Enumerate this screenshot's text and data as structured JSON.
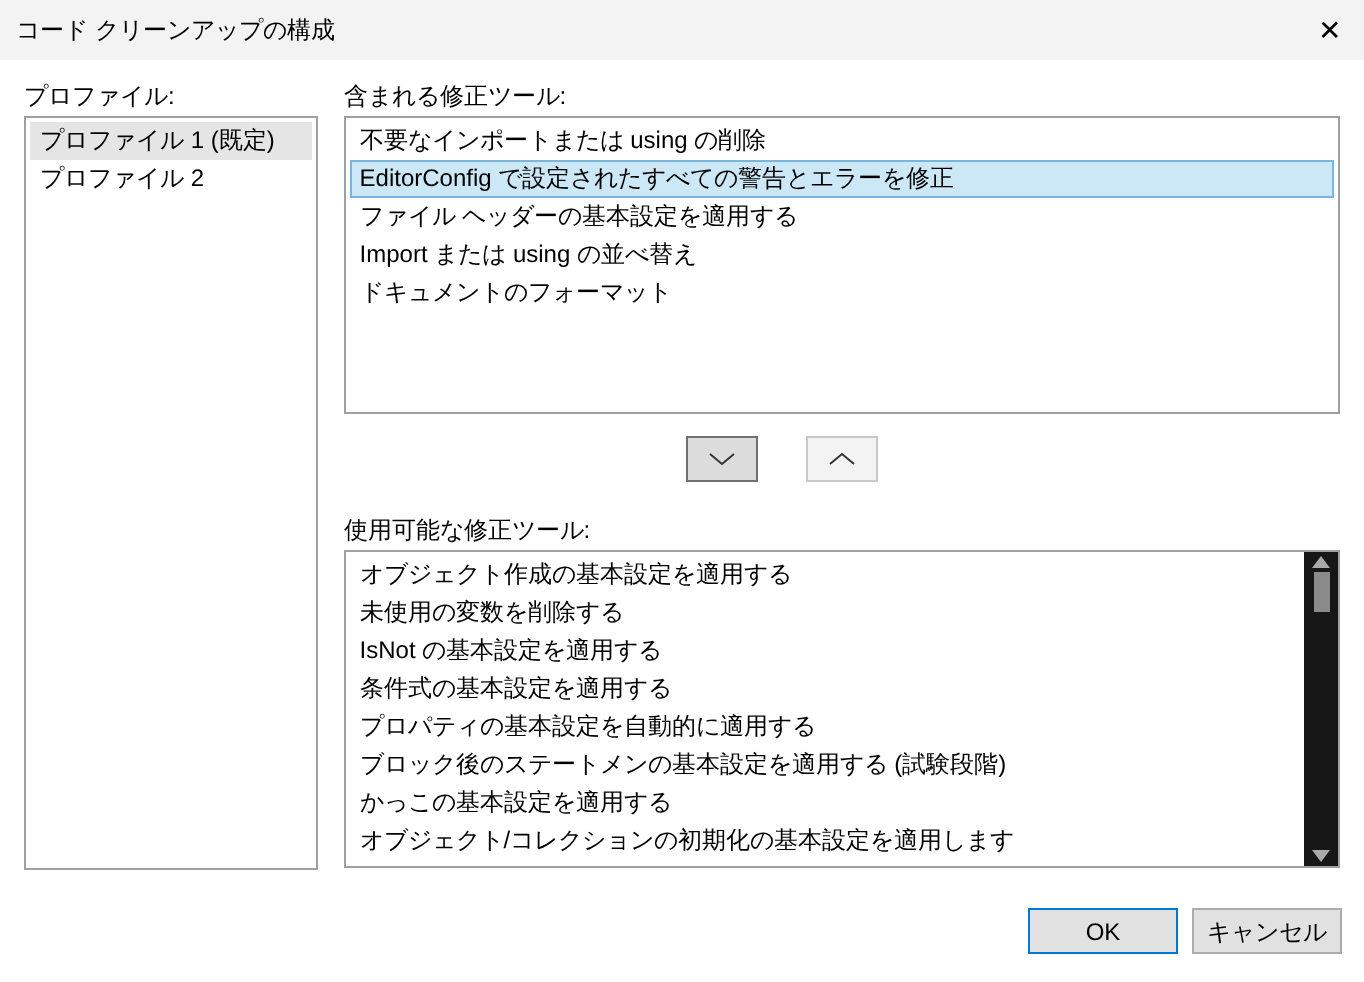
{
  "window": {
    "title": "コード クリーンアップの構成",
    "close": "✕"
  },
  "profiles": {
    "label": "プロファイル:",
    "items": [
      {
        "label": "プロファイル 1 (既定)",
        "selected": true
      },
      {
        "label": "プロファイル 2",
        "selected": false
      }
    ]
  },
  "included_fixers": {
    "label": "含まれる修正ツール:",
    "items": [
      {
        "label": "不要なインポートまたは using の削除",
        "selected": false
      },
      {
        "label": "EditorConfig で設定されたすべての警告とエラーを修正",
        "selected": true
      },
      {
        "label": "ファイル ヘッダーの基本設定を適用する",
        "selected": false
      },
      {
        "label": "Import または using の並べ替え",
        "selected": false
      },
      {
        "label": "ドキュメントのフォーマット",
        "selected": false
      }
    ]
  },
  "move_buttons": [
    {
      "kind": "down",
      "pressed": true
    },
    {
      "kind": "up",
      "pressed": false
    }
  ],
  "available_fixers": {
    "label": "使用可能な修正ツール:",
    "items": [
      {
        "label": "オブジェクト作成の基本設定を適用する"
      },
      {
        "label": "未使用の変数を削除する"
      },
      {
        "label": "IsNot の基本設定を適用する"
      },
      {
        "label": "条件式の基本設定を適用する"
      },
      {
        "label": "プロパティの基本設定を自動的に適用する"
      },
      {
        "label": "ブロック後のステートメンの基本設定を適用する (試験段階)"
      },
      {
        "label": "かっこの基本設定を適用する"
      },
      {
        "label": "オブジェクト/コレクションの初期化の基本設定を適用します"
      }
    ]
  },
  "buttons": [
    {
      "label": "OK",
      "default": true
    },
    {
      "label": "キャンセル",
      "default": false
    }
  ]
}
